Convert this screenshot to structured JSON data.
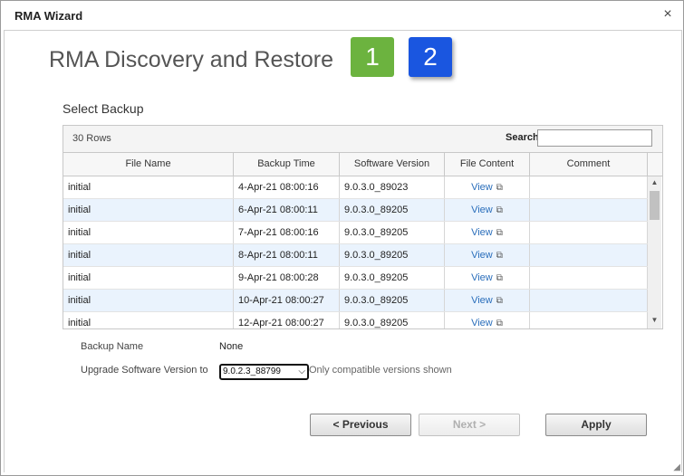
{
  "window": {
    "title": "RMA Wizard",
    "close_glyph": "×"
  },
  "heading": "RMA Discovery and Restore",
  "steps": [
    {
      "label": "1",
      "color": "#6cb33f"
    },
    {
      "label": "2",
      "color": "#1a56e0",
      "active": true
    }
  ],
  "section_label": "Select Backup",
  "grid": {
    "row_count": "30 Rows",
    "search_label": "Search",
    "search_value": "",
    "columns": [
      "File Name",
      "Backup Time",
      "Software Version",
      "File Content",
      "Comment"
    ],
    "rows": [
      {
        "file_name": "initial",
        "backup_time": "4-Apr-21 08:00:16",
        "software_version": "9.0.3.0_89023",
        "file_content": "View",
        "comment": ""
      },
      {
        "file_name": "initial",
        "backup_time": "6-Apr-21 08:00:11",
        "software_version": "9.0.3.0_89205",
        "file_content": "View",
        "comment": ""
      },
      {
        "file_name": "initial",
        "backup_time": "7-Apr-21 08:00:16",
        "software_version": "9.0.3.0_89205",
        "file_content": "View",
        "comment": ""
      },
      {
        "file_name": "initial",
        "backup_time": "8-Apr-21 08:00:11",
        "software_version": "9.0.3.0_89205",
        "file_content": "View",
        "comment": ""
      },
      {
        "file_name": "initial",
        "backup_time": "9-Apr-21 08:00:28",
        "software_version": "9.0.3.0_89205",
        "file_content": "View",
        "comment": ""
      },
      {
        "file_name": "initial",
        "backup_time": "10-Apr-21 08:00:27",
        "software_version": "9.0.3.0_89205",
        "file_content": "View",
        "comment": ""
      },
      {
        "file_name": "initial",
        "backup_time": "12-Apr-21 08:00:27",
        "software_version": "9.0.3.0_89205",
        "file_content": "View",
        "comment": ""
      }
    ],
    "link_icon": "external-link-icon",
    "alt_row_color": "#eaf3fd"
  },
  "form": {
    "backup_name_label": "Backup Name",
    "backup_name_value": "None",
    "upgrade_label": "Upgrade Software Version to",
    "upgrade_value": "9.0.2.3_88799",
    "upgrade_hint": "Only compatible versions shown"
  },
  "buttons": {
    "previous": "< Previous",
    "next": "Next >",
    "apply": "Apply"
  }
}
